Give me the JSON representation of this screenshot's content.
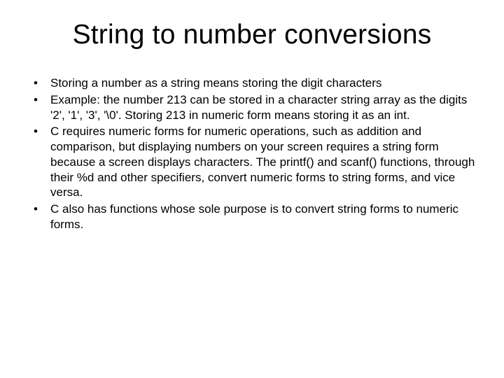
{
  "title": "String to number conversions",
  "bullets": [
    "Storing a number as a string means storing the digit characters",
    "Example: the number 213 can be stored in a character string array as the digits '2', '1', '3', '\\0'. Storing 213 in numeric form means storing it as an int.",
    "C requires numeric forms for numeric operations, such as addition and comparison, but displaying numbers on your screen requires a string form because a screen displays characters. The printf() and scanf() functions, through their %d and other specifiers, convert numeric forms to string forms, and vice versa.",
    "C also has functions whose sole purpose is to convert string forms to numeric forms."
  ]
}
